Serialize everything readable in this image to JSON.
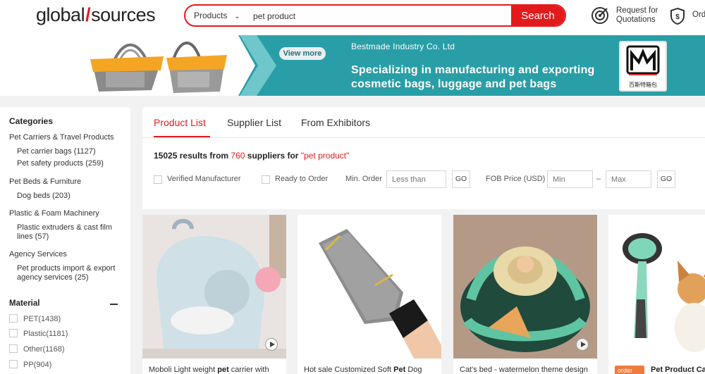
{
  "header": {
    "logo_left": "global",
    "logo_slash": "/",
    "logo_right": "sources",
    "search_category": "Products",
    "search_value": "pet product",
    "search_button": "Search",
    "rfq_line1": "Request for",
    "rfq_line2": "Quotations",
    "orders_label": "Ord"
  },
  "banner": {
    "view_more": "View more",
    "company": "Bestmade Industry Co. Ltd",
    "tagline_line1": "Specializing in manufacturing and exporting",
    "tagline_line2": "cosmetic bags, luggage and pet bags",
    "brand_caption": "百斯特箱包"
  },
  "sidebar": {
    "title": "Categories",
    "groups": [
      {
        "label": "Pet Carriers & Travel Products",
        "items": [
          "Pet carrier bags (1127)",
          "Pet safety products (259)"
        ]
      },
      {
        "label": "Pet Beds & Furniture",
        "items": [
          "Dog beds (203)"
        ]
      },
      {
        "label": "Plastic & Foam Machinery",
        "items": [
          "Plastic extruders & cast film",
          "lines (57)"
        ]
      },
      {
        "label": "Agency Services",
        "items": [
          "Pet products import & export",
          "agency services (25)"
        ]
      }
    ],
    "material_title": "Material",
    "materials": [
      "PET(1438)",
      "Plastic(1181)",
      "Other(1168)",
      "PP(904)"
    ]
  },
  "main": {
    "tabs": [
      "Product List",
      "Supplier List",
      "From Exhibitors"
    ],
    "results_count": "15025",
    "results_mid": "results from",
    "suppliers_count": "760",
    "suppliers_text": "suppliers for",
    "query_quoted": "\"pet product\"",
    "filters": {
      "verified": "Verified Manufacturer",
      "ready": "Ready to Order",
      "min_order_label": "Min. Order",
      "min_order_placeholder": "Less than",
      "go": "GO",
      "fob_label": "FOB Price (USD)",
      "min_placeholder": "Min",
      "dash": "–",
      "max_placeholder": "Max"
    }
  },
  "products": [
    {
      "title_pre": "Moboli Light weight ",
      "title_bold": "pet",
      "title_post": " carrier with"
    },
    {
      "title_pre": "Hot sale Customized Soft ",
      "title_bold": "Pet",
      "title_post": " Dog"
    },
    {
      "title_pre": "Cat's bed - watermelon theme design",
      "title_bold": "",
      "title_post": ""
    },
    {
      "badge": "order",
      "title_pre": "",
      "title_bold": "Pet Product Ca",
      "title_post": ""
    }
  ],
  "colors": {
    "brand_red": "#e31a1c",
    "banner_teal": "#2a9ea6"
  }
}
